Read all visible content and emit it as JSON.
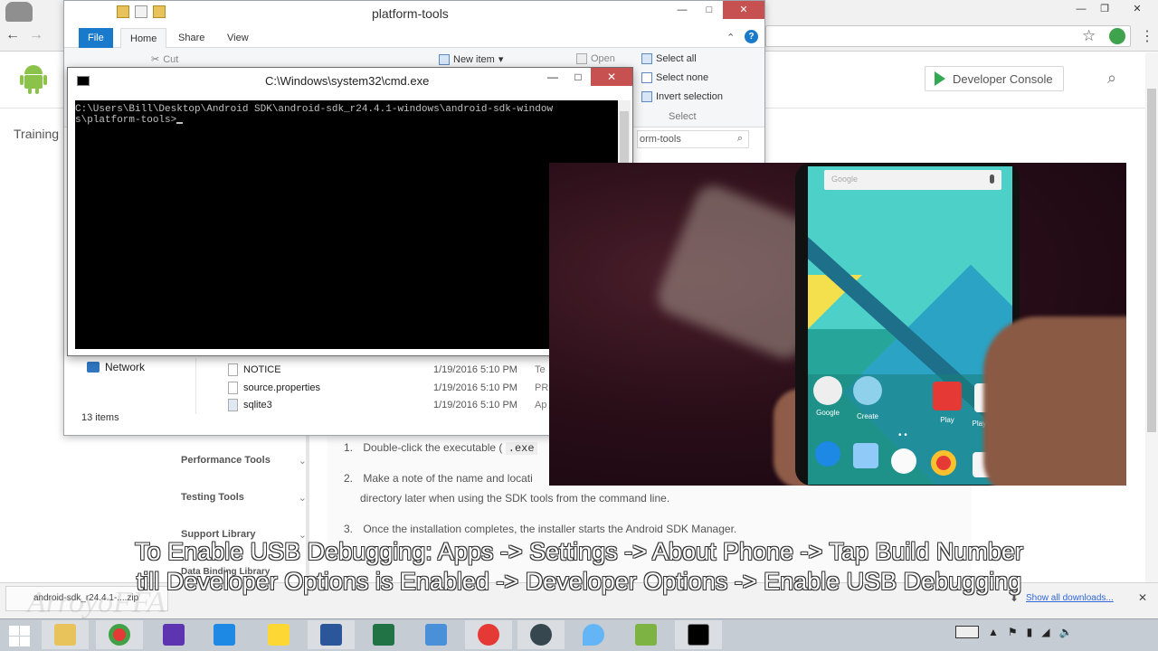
{
  "browser": {
    "dev_console_label": "Developer Console",
    "training_label": "Training",
    "left_nav": [
      {
        "label": "Performance Tools"
      },
      {
        "label": "Testing Tools"
      },
      {
        "label": "Support Library"
      },
      {
        "label": "Data Binding Library"
      }
    ],
    "steps": [
      {
        "num": "1.",
        "text": "Double-click the executable (",
        "code": ".exe"
      },
      {
        "num": "2.",
        "text": "Make a note of the name and locati",
        "line2": "directory later when using the SDK tools from the command line."
      },
      {
        "num": "3.",
        "text": "Once the installation completes, the installer starts the Android SDK Manager."
      }
    ],
    "download_bar": {
      "filename": "android-sdk_r24.4.1-....zip",
      "show_all": "Show all downloads..."
    }
  },
  "explorer": {
    "title": "platform-tools",
    "tabs": {
      "file": "File",
      "home": "Home",
      "share": "Share",
      "view": "View"
    },
    "ribbon": {
      "cut": "Cut",
      "new_item": "New item",
      "open": "Open",
      "select_all": "Select all",
      "select_none": "Select none",
      "invert_selection": "Invert selection",
      "select_group": "Select"
    },
    "search_text": "orm-tools",
    "nav_network": "Network",
    "files": [
      {
        "name": "NOTICE",
        "date": "1/19/2016 5:10 PM",
        "type": "Te"
      },
      {
        "name": "source.properties",
        "date": "1/19/2016 5:10 PM",
        "type": "PR"
      },
      {
        "name": "sqlite3",
        "date": "1/19/2016 5:10 PM",
        "type": "Ap"
      }
    ],
    "status": "13 items"
  },
  "cmd": {
    "title": "C:\\Windows\\system32\\cmd.exe",
    "line1": "C:\\Users\\Bill\\Desktop\\Android SDK\\android-sdk_r24.4.1-windows\\android-sdk-window",
    "line2": "s\\platform-tools>"
  },
  "phone": {
    "search_hint": "Google",
    "apps": [
      {
        "label": "Google"
      },
      {
        "label": "Create"
      },
      {
        "label": "Play"
      },
      {
        "label": "Play Store"
      }
    ]
  },
  "subtitle": {
    "line1": "To Enable USB Debugging: Apps -> Settings -> About Phone -> Tap Build Number",
    "line2": "till Developer Options is Enabled -> Developer Options -> Enable USB Debugging"
  },
  "watermark": "ArroyoFFA",
  "colors": {
    "ribbon_file_tab": "#1979ca",
    "close_button": "#c75050",
    "cmd_background": "#000000",
    "taskbar": "#c6ccd3"
  }
}
